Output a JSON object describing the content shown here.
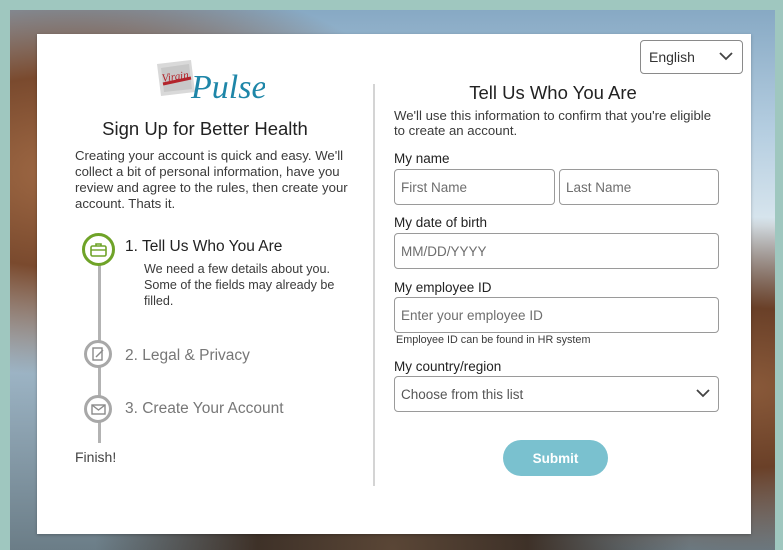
{
  "brand": {
    "logo_small": "Virgin",
    "logo_main": "Pulse",
    "accent_color": "#1e86a8",
    "step_active_color": "#6fa328",
    "submit_color": "#7ac1cf"
  },
  "language": {
    "selected": "English",
    "icon": "chevron-down-icon"
  },
  "left": {
    "title": "Sign Up for Better Health",
    "intro": "Creating your account is quick and easy. We'll collect a bit of personal information, have you review and agree to the rules, then create your account. Thats it.",
    "steps": [
      {
        "label": "1. Tell Us Who You Are",
        "description": "We need a few details about you. Some of the fields may already be filled.",
        "icon": "briefcase-icon",
        "active": true
      },
      {
        "label": "2. Legal & Privacy",
        "icon": "document-sign-icon",
        "active": false
      },
      {
        "label": "3. Create Your Account",
        "icon": "envelope-icon",
        "active": false
      }
    ],
    "finish": "Finish!"
  },
  "form": {
    "title": "Tell Us Who You Are",
    "intro": "We'll use this information to confirm that you're eligible to create an account.",
    "name": {
      "label": "My name",
      "first_placeholder": "First Name",
      "last_placeholder": "Last Name"
    },
    "dob": {
      "label": "My date of birth",
      "placeholder": "MM/DD/YYYY"
    },
    "employee_id": {
      "label": "My employee ID",
      "placeholder": "Enter your employee ID",
      "hint": "Employee ID can be found in HR system"
    },
    "country": {
      "label": "My country/region",
      "selected": "Choose from this list"
    },
    "submit_label": "Submit"
  }
}
